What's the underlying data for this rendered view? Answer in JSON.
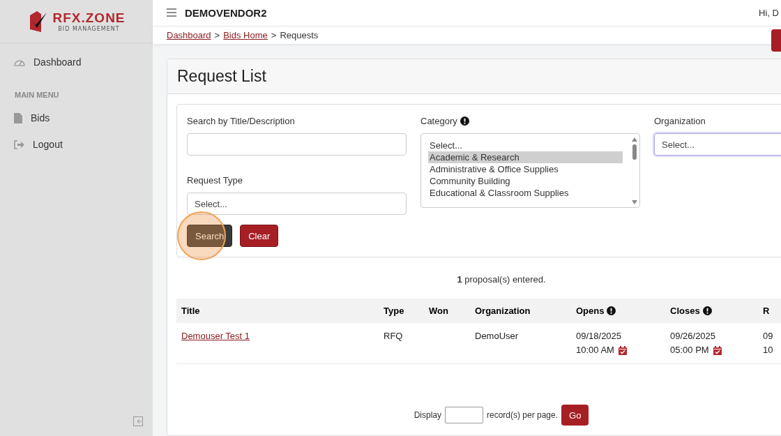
{
  "brand": {
    "name": "RFX.ZONE",
    "tagline": "BID MANAGEMENT"
  },
  "sidebar": {
    "items": [
      {
        "label": "Dashboard",
        "selected": false
      }
    ],
    "section": "MAIN MENU",
    "menu": [
      {
        "label": "Bids",
        "selected": false
      },
      {
        "label": "Logout",
        "selected": false
      }
    ]
  },
  "header": {
    "vendor": "DEMOVENDOR2",
    "greeting": "Hi, D"
  },
  "breadcrumb": [
    {
      "label": "Dashboard",
      "kind": "link"
    },
    {
      "label": ">",
      "kind": "separator"
    },
    {
      "label": "Bids Home",
      "kind": "link"
    },
    {
      "label": ">",
      "kind": "separator"
    },
    {
      "label": "Requests",
      "kind": "current"
    }
  ],
  "page_title": "Request List",
  "filters": {
    "search": {
      "label": "Search by Title/Description"
    },
    "request_type": {
      "label": "Request Type",
      "placeholder": "Select..."
    },
    "category": {
      "label": "Category",
      "options": [
        {
          "label": "Select...",
          "selected": false
        },
        {
          "label": "Academic & Research",
          "selected": true
        },
        {
          "label": "Administrative & Office Supplies",
          "selected": false
        },
        {
          "label": "Community Building",
          "selected": false
        },
        {
          "label": "Educational & Classroom Supplies",
          "selected": false
        }
      ]
    },
    "organization": {
      "label": "Organization",
      "placeholder": "Select...",
      "focused": true
    },
    "buttons": [
      {
        "label": "Search",
        "kind": "primary"
      },
      {
        "label": "Clear",
        "kind": "danger"
      }
    ]
  },
  "count": {
    "number": "1",
    "text": "proposal(s) entered."
  },
  "table": {
    "columns": [
      {
        "label": "Title",
        "info": false
      },
      {
        "label": "Type",
        "info": false
      },
      {
        "label": "Won",
        "info": false
      },
      {
        "label": "Organization",
        "info": false
      },
      {
        "label": "Opens",
        "info": true
      },
      {
        "label": "Closes",
        "info": true
      },
      {
        "label": "R",
        "info": false
      }
    ],
    "rows": [
      {
        "title": "Demouser Test 1",
        "type": "RFQ",
        "organization": "DemoUser",
        "opens": {
          "date": "09/18/2025",
          "time": "10:00 AM",
          "calendar": true
        },
        "closes": {
          "date": "09/26/2025",
          "time": "05:00 PM",
          "calendar": true
        },
        "column_7": {
          "date": "09",
          "time": "10",
          "calendar": false
        }
      }
    ]
  },
  "pagination": {
    "before": "Display",
    "after": "record(s) per page.",
    "button": "Go"
  }
}
